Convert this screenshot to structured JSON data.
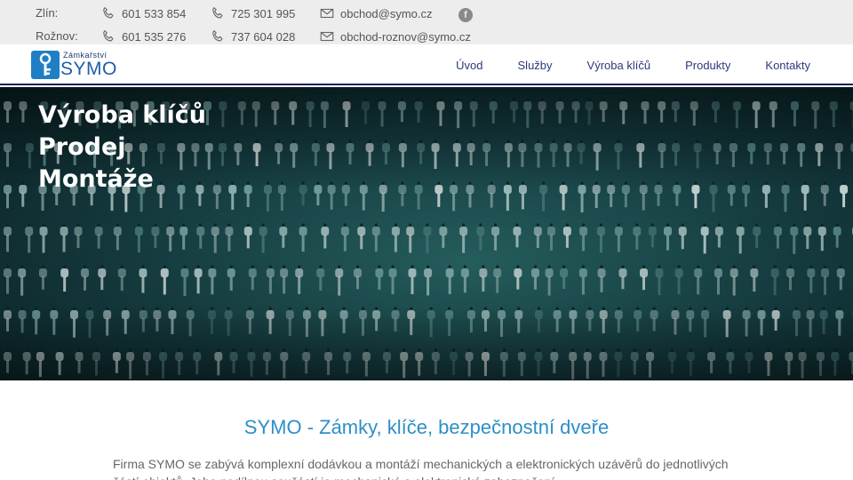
{
  "contacts": [
    {
      "city": "Zlín:",
      "phone1": "601 533 854",
      "phone2": "725 301 995",
      "email": "obchod@symo.cz"
    },
    {
      "city": "Rožnov:",
      "phone1": "601 535 276",
      "phone2": "737 604 028",
      "email": "obchod-roznov@symo.cz"
    }
  ],
  "social": {
    "facebook_glyph": "f"
  },
  "logo": {
    "small": "Zámkařství",
    "big": "SYMO"
  },
  "nav": [
    "Úvod",
    "Služby",
    "Výroba klíčů",
    "Produkty",
    "Kontakty"
  ],
  "hero": {
    "lines": [
      "Výroba klíčů",
      "Prodej",
      "Montáže"
    ]
  },
  "content": {
    "heading": "SYMO - Zámky, klíče, bezpečnostní dveře",
    "paragraph": "Firma SYMO se zabývá komplexní dodávkou a montáží mechanických a elektronických uzávěrů do jednotlivých částí objektů. Jeho nedílnou součástí je mechanické a elektronické zabezpečení"
  },
  "colors": {
    "accent": "#2e8fc6",
    "nav": "#2b3a7a",
    "topbar": "#ededed",
    "hero": "#1f5a5c"
  }
}
